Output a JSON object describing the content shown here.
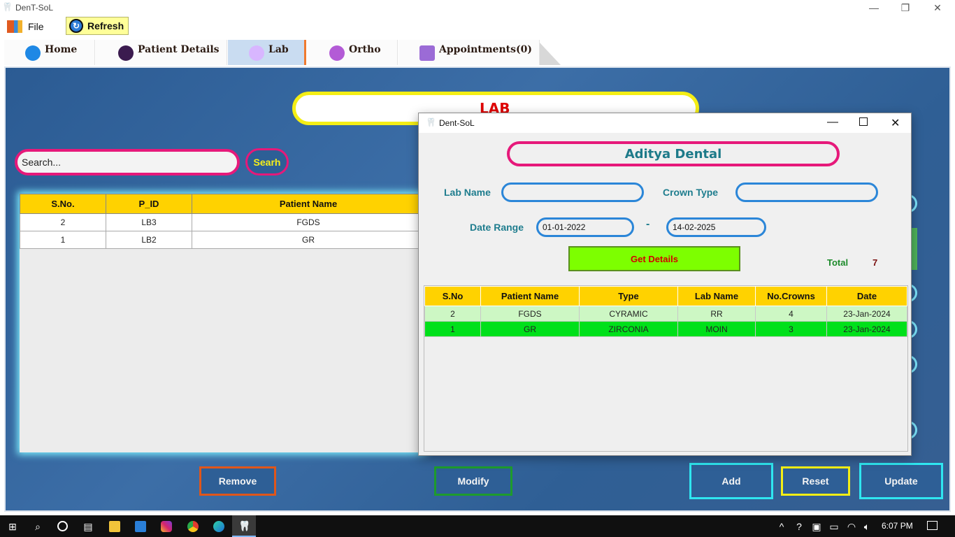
{
  "window": {
    "title": "DenT-SoL",
    "minimize": "—",
    "restore": "❐",
    "close": "✕"
  },
  "menu": {
    "file": "File",
    "refresh": "Refresh"
  },
  "tabs": [
    {
      "label": "Home",
      "icon": "home-icon",
      "color": "#1e88e5"
    },
    {
      "label": "Patient Details",
      "icon": "user-icon",
      "color": "#3b1b4f"
    },
    {
      "label": "Lab",
      "icon": "flask-icon",
      "color": "#d8b6ff"
    },
    {
      "label": "Ortho",
      "icon": "tooth-braces-icon",
      "color": "#b35bd6"
    },
    {
      "label": "Appointments(0)",
      "icon": "calendar-icon",
      "color": "#9b6bd6"
    }
  ],
  "main": {
    "banner": "LAB",
    "search": {
      "placeholder": "Search...",
      "button": "Searh"
    },
    "table": {
      "headers": [
        "S.No.",
        "P_ID",
        "Patient Name"
      ],
      "rows": [
        [
          "2",
          "LB3",
          "FGDS"
        ],
        [
          "1",
          "LB2",
          "GR"
        ]
      ]
    },
    "buttons": {
      "remove": "Remove",
      "modify": "Modify",
      "add": "Add",
      "reset": "Reset",
      "update": "Update"
    }
  },
  "dialog": {
    "title": "Dent-SoL",
    "clinic": "Aditya Dental",
    "lab_name_label": "Lab Name",
    "lab_name_value": "",
    "crown_type_label": "Crown Type",
    "crown_type_value": "",
    "date_range_label": "Date Range",
    "date_from": "01-01-2022",
    "date_sep": "-",
    "date_to": "14-02-2025",
    "get_details": "Get Details",
    "total_label": "Total",
    "total_value": "7",
    "table": {
      "headers": [
        "S.No",
        "Patient Name",
        "Type",
        "Lab Name",
        "No.Crowns",
        "Date"
      ],
      "rows": [
        [
          "2",
          "FGDS",
          "CYRAMIC",
          "RR",
          "4",
          "23-Jan-2024"
        ],
        [
          "1",
          "GR",
          "ZIRCONIA",
          "MOIN",
          "3",
          "23-Jan-2024"
        ]
      ]
    }
  },
  "taskbar": {
    "time": "6:07 PM"
  },
  "colors": {
    "accent_pink": "#e6197a",
    "banner_yellow": "#f4ee15",
    "header_yellow": "#ffd200",
    "selected_row": "#00e01a",
    "row_light": "#cdf7c4"
  }
}
